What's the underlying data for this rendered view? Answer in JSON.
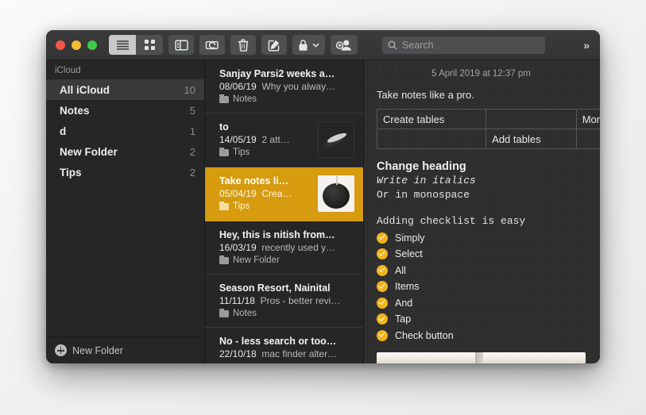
{
  "window": {
    "traffic_lights": [
      "close",
      "minimize",
      "maximize"
    ]
  },
  "toolbar": {
    "list_view_label": "list-view",
    "grid_view_label": "grid-view",
    "sidebar_toggle_label": "toggle-sidebar",
    "attach_label": "attach-file",
    "delete_label": "delete-note",
    "compose_label": "new-note",
    "lock_label": "lock-note",
    "share_label": "add-people",
    "overflow_label": "»",
    "icons": [
      "list-icon",
      "grid-icon",
      "sidebar-icon",
      "paperclip-icon",
      "trash-icon",
      "compose-icon",
      "lock-icon",
      "chevron-down-icon",
      "add-person-icon",
      "search-icon"
    ]
  },
  "search": {
    "placeholder": "Search",
    "value": ""
  },
  "sidebar": {
    "section_title": "iCloud",
    "items": [
      {
        "label": "All iCloud",
        "count": "10",
        "selected": true
      },
      {
        "label": "Notes",
        "count": "5",
        "selected": false
      },
      {
        "label": "d",
        "count": "1",
        "selected": false
      },
      {
        "label": "New Folder",
        "count": "2",
        "selected": false
      },
      {
        "label": "Tips",
        "count": "2",
        "selected": false
      }
    ],
    "footer": {
      "label": "New Folder",
      "icon": "plus-circle-icon"
    }
  },
  "note_list": {
    "notes": [
      {
        "title": "Sanjay Parsi2 weeks a…",
        "date": "08/06/19",
        "preview": "Why you alway…",
        "folder": "Notes",
        "selected": false,
        "thumb": "none"
      },
      {
        "title": "to",
        "date": "14/05/19",
        "preview": "2 att…",
        "folder": "Tips",
        "selected": false,
        "thumb": "pen"
      },
      {
        "title": "Take notes li…",
        "date": "05/04/19",
        "preview": "Crea…",
        "folder": "Tips",
        "selected": true,
        "thumb": "speaker"
      },
      {
        "title": "Hey, this is nitish from…",
        "date": "16/03/19",
        "preview": "recently used y…",
        "folder": "New Folder",
        "selected": false,
        "thumb": "none"
      },
      {
        "title": "Season Resort, Nainital",
        "date": "11/11/18",
        "preview": "Pros - better revi…",
        "folder": "Notes",
        "selected": false,
        "thumb": "none"
      },
      {
        "title": "No - less search or too…",
        "date": "22/10/18",
        "preview": "mac finder alter…",
        "folder": "",
        "selected": false,
        "thumb": "none"
      }
    ]
  },
  "detail": {
    "timestamp": "5 April 2019 at 12:37 pm",
    "intro": "Take notes like a pro.",
    "table": {
      "rows": [
        [
          "Create tables",
          "",
          "More"
        ],
        [
          "",
          "Add tables",
          ""
        ]
      ]
    },
    "heading": "Change heading",
    "italic_line": "Write in italics",
    "mono_line": "Or in monospace",
    "checklist_heading": "Adding checklist is easy",
    "checklist": [
      "Simply",
      "Select",
      "All",
      "Items",
      "And",
      "Tap",
      "Check button"
    ],
    "attachment_label": "image-attachment"
  },
  "colors": {
    "selection_gold": "#d79b10",
    "checkbox_yellow": "#f0b41d",
    "sidebar_bg": "#262626",
    "detail_bg": "#2e2e2e",
    "toolbar_bg": "#3b3b3b"
  }
}
